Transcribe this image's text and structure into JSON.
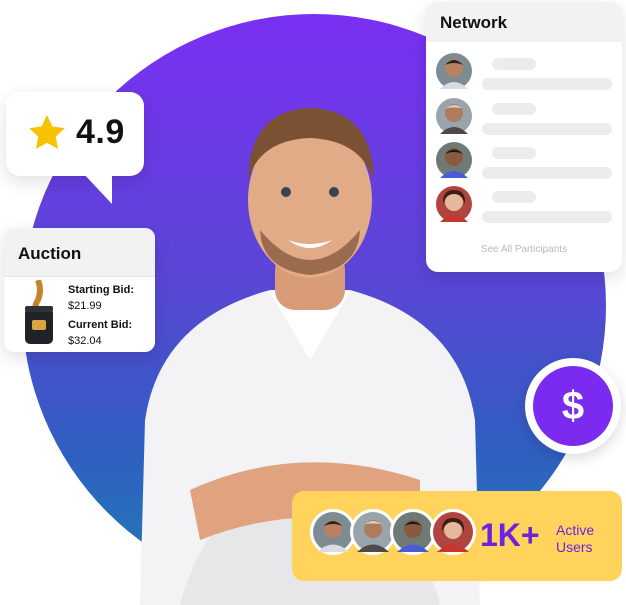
{
  "rating": {
    "value": "4.9",
    "star_color": "#f7c200"
  },
  "auction": {
    "title": "Auction",
    "starting_label": "Starting Bid:",
    "starting_amount": "$21.99",
    "current_label": "Current Bid:",
    "current_amount": "$32.04"
  },
  "network": {
    "title": "Network",
    "participants": [
      {
        "avatar": "participant-avatar-1"
      },
      {
        "avatar": "participant-avatar-2"
      },
      {
        "avatar": "participant-avatar-3"
      },
      {
        "avatar": "participant-avatar-4"
      }
    ],
    "see_all": "See All Participants"
  },
  "badge": {
    "symbol": "$",
    "color": "#7a2bef"
  },
  "users": {
    "count": "1K+",
    "label_line1": "Active",
    "label_line2": "Users"
  },
  "colors": {
    "gradient_top": "#7a2ff2",
    "gradient_bottom": "#1e7fb5",
    "accent": "#6b23e0",
    "yellow": "#ffd35c"
  }
}
